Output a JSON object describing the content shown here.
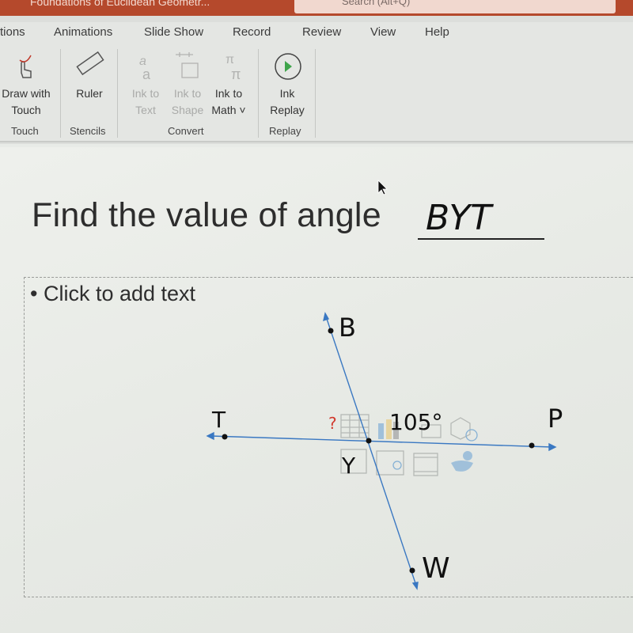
{
  "window": {
    "title": "Foundations of Euclidean Geometr...",
    "search_placeholder": "Search (Alt+Q)",
    "accent": "#b5492c"
  },
  "tabs": [
    "tions",
    "Animations",
    "Slide Show",
    "Record",
    "Review",
    "View",
    "Help"
  ],
  "ribbon": {
    "buttons": [
      {
        "label1": "Draw with",
        "label2": "Touch",
        "icon": "draw-touch-icon",
        "enabled": true
      },
      {
        "label1": "Ruler",
        "label2": "",
        "icon": "ruler-icon",
        "enabled": true
      },
      {
        "label1": "Ink to",
        "label2": "Text",
        "icon": "ink-to-text-icon",
        "enabled": false
      },
      {
        "label1": "Ink to",
        "label2": "Shape",
        "icon": "ink-to-shape-icon",
        "enabled": false
      },
      {
        "label1": "Ink to",
        "label2": "Math ˅",
        "icon": "ink-to-math-icon",
        "enabled": true
      },
      {
        "label1": "Ink",
        "label2": "Replay",
        "icon": "ink-replay-icon",
        "enabled": true
      }
    ],
    "groups": [
      "Touch",
      "Stencils",
      "Convert",
      "Replay"
    ]
  },
  "slide": {
    "title": "Find the value of angle",
    "answer": "BYT",
    "placeholder": "Click to add text",
    "bullet": "•",
    "diagram": {
      "labels": {
        "B": "B",
        "T": "T",
        "P": "P",
        "W": "W",
        "Y": "Y"
      },
      "angle": "105°",
      "question": "?",
      "line_color": "#3a78c2"
    }
  }
}
